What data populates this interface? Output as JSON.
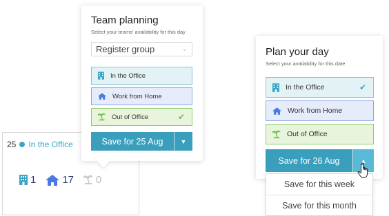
{
  "colors": {
    "accent": "#3a9ebd",
    "office": "#3aa5c6",
    "home": "#4a79e0",
    "out": "#69c14a"
  },
  "day_cell": {
    "date": "25",
    "status": "In the Office",
    "counts": [
      {
        "icon": "building-icon",
        "value": "1"
      },
      {
        "icon": "home-icon",
        "value": "17"
      },
      {
        "icon": "palm-tree-icon",
        "value": "0"
      }
    ]
  },
  "team_planning": {
    "title": "Team planning",
    "subtitle": "Select your teams' availability for this day",
    "select_value": "Register group",
    "options": [
      {
        "label": "In the Office",
        "icon": "building-icon",
        "checked": false
      },
      {
        "label": "Work from Home",
        "icon": "home-icon",
        "checked": false
      },
      {
        "label": "Out of Office",
        "icon": "palm-tree-icon",
        "checked": true
      }
    ],
    "save_label": "Save for 25 Aug"
  },
  "plan_day": {
    "title": "Plan your day",
    "subtitle": "Select your availability for this date",
    "options": [
      {
        "label": "In the Office",
        "icon": "building-icon",
        "checked": true
      },
      {
        "label": "Work from Home",
        "icon": "home-icon",
        "checked": false
      },
      {
        "label": "Out of Office",
        "icon": "palm-tree-icon",
        "checked": false
      }
    ],
    "save_label": "Save for 26 Aug",
    "menu": [
      "Save for this week",
      "Save for this month"
    ]
  }
}
